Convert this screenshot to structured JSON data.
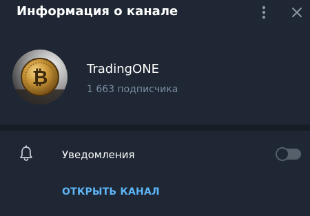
{
  "header": {
    "title": "Информация о канале",
    "menu_icon": "more-vertical-icon",
    "close_icon": "close-icon"
  },
  "channel": {
    "name": "TradingONE",
    "subscribers": "1 663 подписчика",
    "avatar_icon": "bitcoin-coin-avatar"
  },
  "notifications": {
    "icon": "bell-icon",
    "label": "Уведомления",
    "enabled": false
  },
  "actions": {
    "open_channel": "ОТКРЫТЬ КАНАЛ"
  },
  "colors": {
    "background": "#1e2733",
    "divider": "#151d26",
    "muted_text": "#7b8fa3",
    "accent": "#5eb5f7",
    "toggle_off": "#56606b"
  }
}
